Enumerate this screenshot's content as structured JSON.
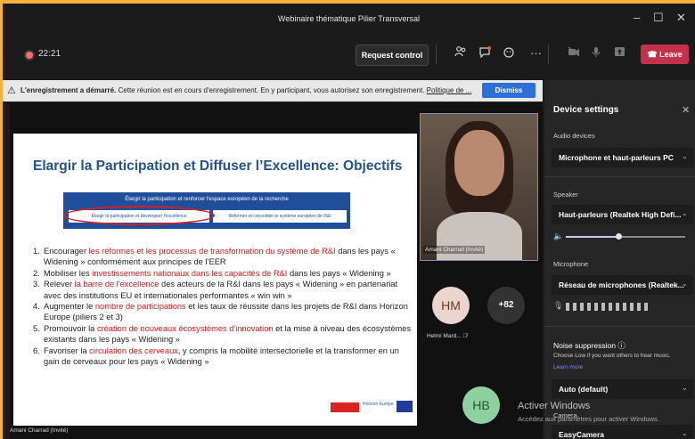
{
  "window": {
    "title": "Webinaire thématique Pilier Transversal",
    "minimize": "–",
    "maximize": "☐",
    "close": "✕"
  },
  "toolbar": {
    "recording_time": "22:21",
    "request_control": "Request control",
    "more": "···",
    "leave": "Leave"
  },
  "banner": {
    "warn_icon": "⚠",
    "bold": "L'enregistrement a démarré.",
    "text": " Cette réunion est en cours d'enregistrement. En y participant, vous autorisez son enregistrement. ",
    "link": "Politique de ...",
    "dismiss": "Dismiss"
  },
  "slide": {
    "title": "Elargir la Participation et Diffuser l’Excellence: Objectifs",
    "box_title": "Élargir la participation et renforcer l'espace européen de la recherche",
    "box_left": "Élargir la participation et développer l'excellence",
    "box_right": "Réformer et consolider le système européen de R&I",
    "items": [
      {
        "num": "1.",
        "a": "Encourager ",
        "h": "les réformes et les processus de transformation du système de R&I",
        "b": " dans les pays « Widening » conformément aux principes de l’EER"
      },
      {
        "num": "2.",
        "a": "Mobiliser les ",
        "h": "investissements nationaux dans les capacités de R&I",
        "b": " dans les pays « Widening »"
      },
      {
        "num": "3.",
        "a": "Relever ",
        "h": "la barre de l'excellence",
        "b": " des acteurs de la R&I dans les pays « Widening » en partenariat avec des institutions EU et internationales performantes « win win »"
      },
      {
        "num": "4.",
        "a": "Augmenter le ",
        "h": "nombre de participations",
        "b": " et les taux de réussite dans les projets de R&I dans Horizon Europe (piliers 2 et 3)"
      },
      {
        "num": "5.",
        "a": "Promouvoir la ",
        "h": "création de nouveaux écosystèmes d'innovation",
        "b": " et la mise à niveau des écosystèmes existants dans les pays « Widening »"
      },
      {
        "num": "6.",
        "a": "Favoriser la ",
        "h": "circulation des cerveaux",
        "b": ", y compris la mobilité intersectorielle et la transformer en un gain de cerveaux pour les pays « Widening »"
      }
    ],
    "logo_text": "Horizon Europe"
  },
  "stage": {
    "presenter_name": "Amani Charrad (Invité)"
  },
  "participants": {
    "speaker_name": "Amani Charrad (Invité)",
    "hm_initials": "HM",
    "hm_name": "Helmi Mard...",
    "more_count": "+82",
    "hb_initials": "HB"
  },
  "device_settings": {
    "title": "Device settings",
    "audio_devices": "Audio devices",
    "audio_device_value": "Microphone et haut-parleurs PC",
    "speaker_label": "Speaker",
    "speaker_value": "Haut-parleurs (Realtek High Defi...",
    "speaker_volume": 0.44,
    "microphone_label": "Microphone",
    "microphone_value": "Réseau de microphones (Realtek...",
    "noise_label": "Noise suppression",
    "noise_hint": "Choose Low if you want others to hear music.",
    "learn_more": "Learn more",
    "noise_value": "Auto (default)",
    "camera_label": "Camera",
    "camera_value": "EasyCamera"
  },
  "watermark": {
    "line1": "Activer Windows",
    "line2": "Accédez aux paramètres pour activer Windows."
  }
}
